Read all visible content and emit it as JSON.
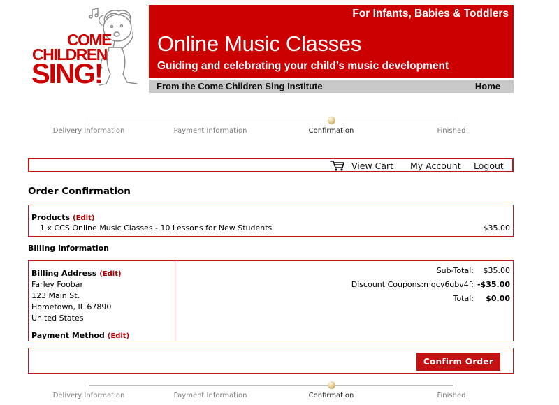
{
  "logo": {
    "line1": "COME",
    "line2": "CHILDREN",
    "line3": "SING!"
  },
  "banner": {
    "tagline": "For Infants, Babies & Toddlers",
    "title": "Online Music Classes",
    "subtitle": "Guiding and celebrating your child’s music development",
    "institute": "From the Come Children Sing Institute",
    "home_link": "Home"
  },
  "progress": {
    "steps": [
      "Delivery Information",
      "Payment Information",
      "Confirmation",
      "Finished!"
    ],
    "current_index": 2
  },
  "nav": {
    "cart_icon": "shopping-cart-icon",
    "view_cart": "View Cart",
    "my_account": "My Account",
    "logout": "Logout"
  },
  "order": {
    "title": "Order Confirmation",
    "products_heading": "Products",
    "edit_label": "(Edit)",
    "products": [
      {
        "description": "1 x CCS Online Music Classes - 10 Lessons for New Students",
        "price": "$35.00"
      }
    ],
    "billing_title": "Billing Information",
    "billing_address_heading": "Billing Address",
    "address": {
      "name": "Farley Foobar",
      "street": "123 Main St.",
      "city": "Hometown, IL 67890",
      "country": "United States"
    },
    "payment_method_heading": "Payment Method",
    "totals": {
      "subtotal_label": "Sub-Total:",
      "subtotal_value": "$35.00",
      "discount_label": "Discount Coupons:mqcy6gbv4f:",
      "discount_value": "-$35.00",
      "total_label": "Total:",
      "total_value": "$0.00"
    },
    "confirm_button": "Confirm Order"
  },
  "colors": {
    "brand_red": "#cc0000",
    "gray_bar": "#c8c8c8",
    "border_red": "#c01818"
  }
}
